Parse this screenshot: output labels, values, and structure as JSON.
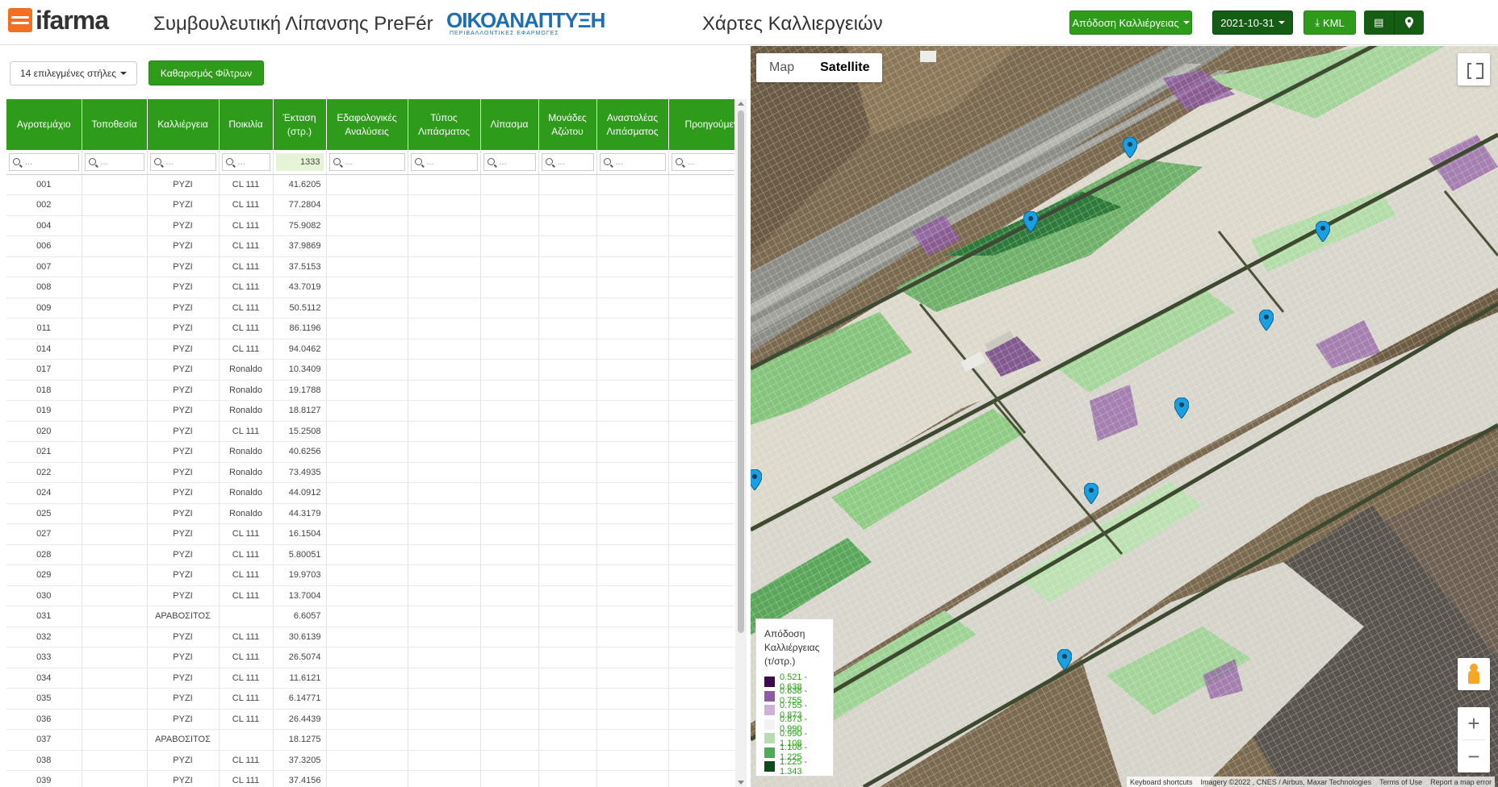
{
  "header": {
    "logo_text": "ifarma",
    "app_title": "Συμβουλευτική Λίπανσης PreFér",
    "partner_name": "ΟΙΚΟΑΝΑΠΤΥΞΗ",
    "partner_sub": "ΠΕΡΙΒΑΛΛΟΝΤΙΚΕΣ ΕΦΑΡΜΟΓΕΣ",
    "page_title": "Χάρτες Καλλιεργειών",
    "layer_button": "Απόδοση Καλλιέργειας",
    "date_button": "2021-10-31",
    "kml_button": "KML",
    "colors": {
      "accent": "#2e9b1b",
      "dark": "#155c14"
    }
  },
  "toolbar": {
    "columns_button": "14 επιλεγμένες στήλες",
    "clear_filters_button": "Καθαρισμός Φίλτρων"
  },
  "table": {
    "headers": [
      "Αγροτεμάχιο",
      "Τοποθεσία",
      "Καλλιέργεια",
      "Ποικιλία",
      "Έκταση (στρ.)",
      "Εδαφολογικές Αναλύσεις",
      "Τύπος Λιπάσματος",
      "Λίπασμα",
      "Μονάδες Αζώτου",
      "Αναστολέας Λιπάσματος",
      "Προηγούμενη Καλλιέργεια"
    ],
    "filter_placeholder": "...",
    "area_total": "1333",
    "rows": [
      [
        "001",
        "",
        "ΡΥΖΙ",
        "CL 111",
        "41.6205"
      ],
      [
        "002",
        "",
        "ΡΥΖΙ",
        "CL 111",
        "77.2804"
      ],
      [
        "004",
        "",
        "ΡΥΖΙ",
        "CL 111",
        "75.9082"
      ],
      [
        "006",
        "",
        "ΡΥΖΙ",
        "CL 111",
        "37.9869"
      ],
      [
        "007",
        "",
        "ΡΥΖΙ",
        "CL 111",
        "37.5153"
      ],
      [
        "008",
        "",
        "ΡΥΖΙ",
        "CL 111",
        "43.7019"
      ],
      [
        "009",
        "",
        "ΡΥΖΙ",
        "CL 111",
        "50.5112"
      ],
      [
        "011",
        "",
        "ΡΥΖΙ",
        "CL 111",
        "86.1196"
      ],
      [
        "014",
        "",
        "ΡΥΖΙ",
        "CL 111",
        "94.0462"
      ],
      [
        "017",
        "",
        "ΡΥΖΙ",
        "Ronaldo",
        "10.3409"
      ],
      [
        "018",
        "",
        "ΡΥΖΙ",
        "Ronaldo",
        "19.1788"
      ],
      [
        "019",
        "",
        "ΡΥΖΙ",
        "Ronaldo",
        "18.8127"
      ],
      [
        "020",
        "",
        "ΡΥΖΙ",
        "CL 111",
        "15.2508"
      ],
      [
        "021",
        "",
        "ΡΥΖΙ",
        "Ronaldo",
        "40.6256"
      ],
      [
        "022",
        "",
        "ΡΥΖΙ",
        "Ronaldo",
        "73.4935"
      ],
      [
        "024",
        "",
        "ΡΥΖΙ",
        "Ronaldo",
        "44.0912"
      ],
      [
        "025",
        "",
        "ΡΥΖΙ",
        "Ronaldo",
        "44.3179"
      ],
      [
        "027",
        "",
        "ΡΥΖΙ",
        "CL 111",
        "16.1504"
      ],
      [
        "028",
        "",
        "ΡΥΖΙ",
        "CL 111",
        "5.80051"
      ],
      [
        "029",
        "",
        "ΡΥΖΙ",
        "CL 111",
        "19.9703"
      ],
      [
        "030",
        "",
        "ΡΥΖΙ",
        "CL 111",
        "13.7004"
      ],
      [
        "031",
        "",
        "ΑΡΑΒΟΣΙΤΟΣ",
        "",
        "6.6057"
      ],
      [
        "032",
        "",
        "ΡΥΖΙ",
        "CL 111",
        "30.6139"
      ],
      [
        "033",
        "",
        "ΡΥΖΙ",
        "CL 111",
        "26.5074"
      ],
      [
        "034",
        "",
        "ΡΥΖΙ",
        "CL 111",
        "11.6121"
      ],
      [
        "035",
        "",
        "ΡΥΖΙ",
        "CL 111",
        "6.14771"
      ],
      [
        "036",
        "",
        "ΡΥΖΙ",
        "CL 111",
        "26.4439"
      ],
      [
        "037",
        "",
        "ΑΡΑΒΟΣΙΤΟΣ",
        "",
        "18.1275"
      ],
      [
        "038",
        "",
        "ΡΥΖΙ",
        "CL 111",
        "37.3205"
      ],
      [
        "039",
        "",
        "ΡΥΖΙ",
        "CL 111",
        "37.4156"
      ]
    ]
  },
  "map": {
    "type_map": "Map",
    "type_satellite": "Satellite",
    "legend_title": "Απόδοση Καλλιέργειας (τ/στρ.)",
    "legend_items": [
      {
        "label": "0.521 - 0.638",
        "color": "#3d0a4f"
      },
      {
        "label": "0.638 - 0.755",
        "color": "#8e5aa3"
      },
      {
        "label": "0.755 - 0.873",
        "color": "#cfb0d8"
      },
      {
        "label": "0.873 - 0.990",
        "color": "#f4f1f4"
      },
      {
        "label": "0.990 - 1.108",
        "color": "#b7deb0"
      },
      {
        "label": "1.108 - 1.225",
        "color": "#4faa55"
      },
      {
        "label": "1.225 - 1.343",
        "color": "#0d4a1c"
      }
    ],
    "attribution": [
      "Keyboard shortcuts",
      "Imagery ©2022 , CNES / Airbus, Maxar Technologies",
      "Terms of Use",
      "Report a map error"
    ]
  }
}
